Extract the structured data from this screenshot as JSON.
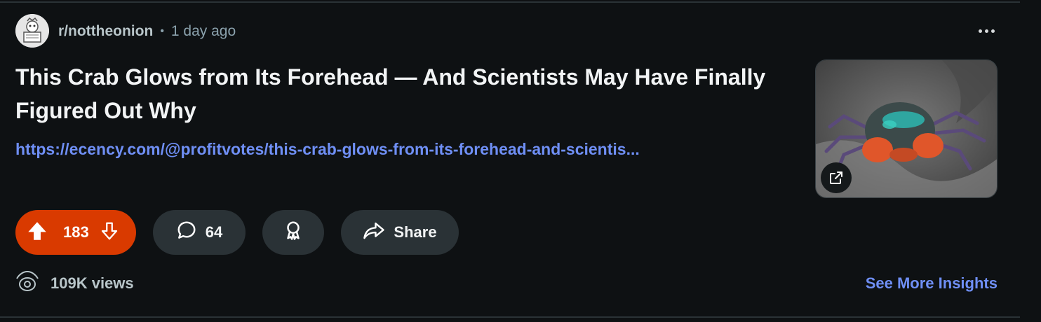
{
  "post": {
    "subreddit": "r/nottheonion",
    "separator": "•",
    "age": "1 day ago",
    "title": "This Crab Glows from Its Forehead — And Scientists May Have Finally Figured Out Why",
    "link_url": "https://ecency.com/@profitvotes/this-crab-glows-from-its-forehead-and-scientists-may-have-finally-figured-out-why",
    "link_display": "https://ecency.com/@profitvotes/this-crab-glows-from-its-forehead-and-scientis..."
  },
  "actions": {
    "score": "183",
    "comments": "64",
    "share_label": "Share",
    "upvote_active": true
  },
  "footer": {
    "views": "109K views",
    "insights_label": "See More Insights"
  },
  "icons": {
    "more": "more-options-icon",
    "external": "external-link-icon",
    "upvote": "arrow-up-icon",
    "downvote": "arrow-down-icon",
    "comment": "comment-bubble-icon",
    "award": "award-ribbon-icon",
    "share": "share-arrow-icon",
    "views": "views-eye-icon"
  },
  "colors": {
    "background": "#0e1113",
    "upvote_active": "#d93a00",
    "link": "#6f8ff5",
    "pill": "#2a3236"
  }
}
